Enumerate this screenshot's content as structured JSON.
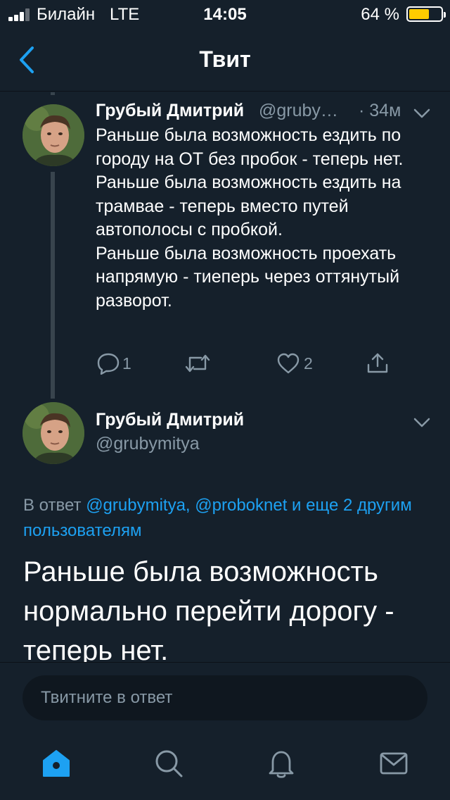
{
  "status_bar": {
    "carrier": "Билайн",
    "network": "LTE",
    "time": "14:05",
    "battery_percent": "64 %",
    "battery_level": 0.64
  },
  "nav": {
    "title": "Твит",
    "back_icon": "chevron-left-icon"
  },
  "parent_tweet": {
    "author_name": "Грубый Дмитрий",
    "author_handle": "@gruby…",
    "time_ago": "· 34м",
    "lines": [
      "Раньше была возможность ездить по городу на ОТ без пробок - теперь нет.",
      "Раньше была возможность ездить на трамвае - теперь вместо путей автополосы с пробкой.",
      "Раньше была возможность проехать напрямую - тиеперь через оттянутый разворот."
    ],
    "actions": {
      "reply_count": "1",
      "retweet_count": "",
      "like_count": "2"
    }
  },
  "main_tweet": {
    "author_name": "Грубый Дмитрий",
    "author_handle": "@grubymitya",
    "reply_prefix": "В ответ ",
    "reply_links": "@grubymitya, @proboknet и еще 2 другим пользователям",
    "text": "Раньше была возможность нормально перейти дорогу - теперь нет."
  },
  "reply_bar": {
    "placeholder": "Твитните в ответ"
  },
  "tab_bar": {
    "tabs": [
      "home-icon",
      "search-icon",
      "notifications-icon",
      "messages-icon"
    ]
  },
  "colors": {
    "background": "#15202b",
    "accent": "#1da1f2",
    "secondary_text": "#8899a6",
    "battery": "#ffcc00"
  }
}
